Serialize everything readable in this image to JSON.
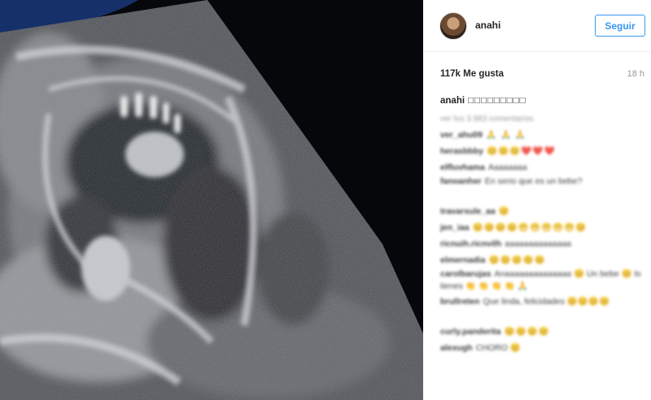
{
  "post": {
    "username": "anahi",
    "follow_label": "Seguir",
    "likes": "117k Me gusta",
    "time_ago": "18 h",
    "caption_user": "anahi",
    "caption_text": "□□□□□□□□□",
    "view_all": "ver los 3.983 comentarios"
  },
  "comments": [
    {
      "user": "ver_ahu09",
      "text": "🙏 🙏 🙏"
    },
    {
      "user": "herasbbby",
      "text": "😊😊😊❤️❤️❤️"
    },
    {
      "user": "elfluvhama",
      "text": "Aaaaaaaa"
    },
    {
      "user": "fanoanher",
      "text": "En serio que es un bebe?"
    },
    {
      "user": "travarsule_aa",
      "text": "😊"
    },
    {
      "user": "jen_iaa",
      "text": "😊😊😊😊😬😬😬😬😬😊"
    },
    {
      "user": "ricnuih.ricnvilh",
      "text": "aaaaaaaaaaaaaa"
    },
    {
      "user": "elmernadia",
      "text": "😊😊😊😊😊"
    },
    {
      "user": "carolbarujas",
      "text": "Anaaaaaaaaaaaaaa 😊 Un bebe 😊 lo tienes 👏 👏 👏 👏 🙏"
    },
    {
      "user": "brullreten",
      "text": "Que linda, felicidades 😊😊😊😊"
    },
    {
      "user": "curly.panderita",
      "text": "😊😊😊😊"
    },
    {
      "user": "alexugh",
      "text": "CHORO 😊"
    }
  ],
  "colors": {
    "accent": "#3897f0",
    "panel_bg": "#ffffff",
    "text": "#262626",
    "muted": "#999999"
  }
}
